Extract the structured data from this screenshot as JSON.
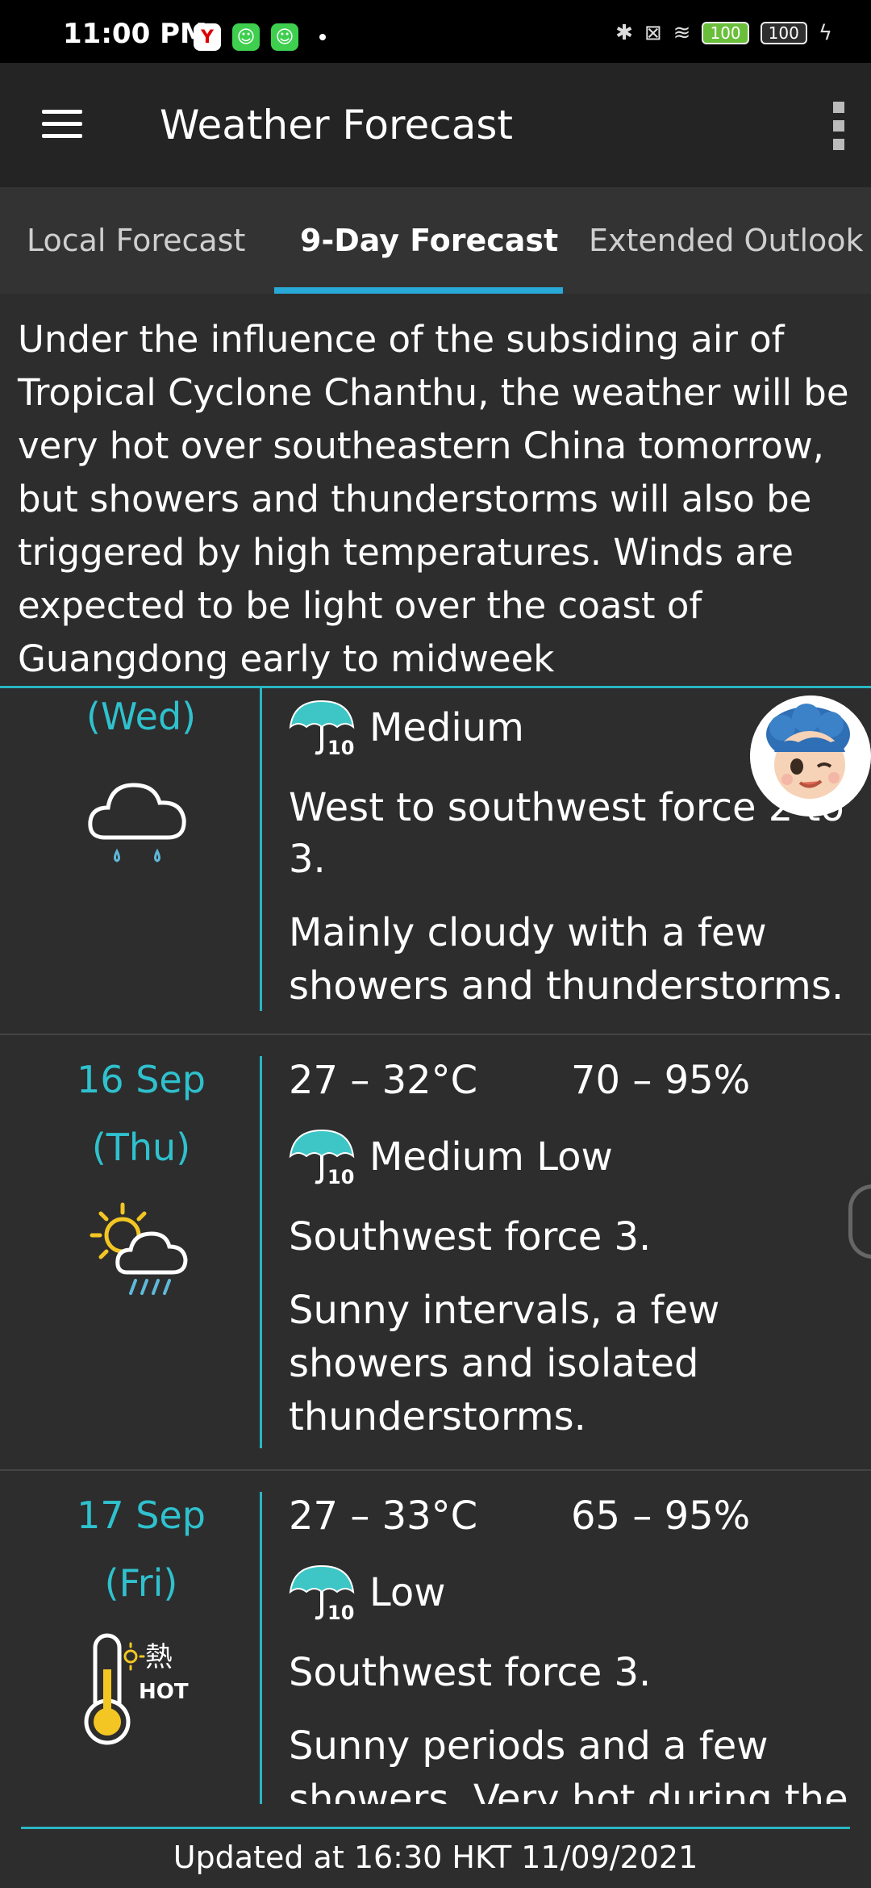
{
  "status_bar": {
    "time": "11:00 PM",
    "battery_1": "100",
    "battery_2": "100"
  },
  "app_bar": {
    "title": "Weather Forecast"
  },
  "tabs": [
    {
      "label": "Local Forecast"
    },
    {
      "label": "9-Day Forecast"
    },
    {
      "label": "Extended Outlook"
    }
  ],
  "general_situation": "Under the influence of the subsiding air of Tropical Cyclone Chanthu, the weather will be very hot over southeastern China tomorrow, but showers and thunderstorms will also be triggered by high temperatures. Winds are expected to be light over the coast of Guangdong early to midweek",
  "forecast": [
    {
      "day": "(Wed)",
      "icon": "rain-cloud-icon",
      "rain_chance": "Medium",
      "wind": "West to southwest force 2 to 3.",
      "description": "Mainly cloudy with a few showers and thunderstorms."
    },
    {
      "date": "16 Sep",
      "day": "(Thu)",
      "icon": "sun-cloud-showers-icon",
      "temperature": "27 – 32°C",
      "humidity": "70 – 95%",
      "rain_chance": "Medium Low",
      "wind": "Southwest force 3.",
      "description": "Sunny intervals, a few showers and isolated thunderstorms."
    },
    {
      "date": "17 Sep",
      "day": "(Fri)",
      "icon": "very-hot-thermometer-icon",
      "icon_text": {
        "cn": "熱",
        "en": "HOT"
      },
      "temperature": "27 – 33°C",
      "humidity": "65 – 95%",
      "rain_chance": "Low",
      "wind": "Southwest force 3.",
      "description": "Sunny periods and a few showers. Very hot during the"
    }
  ],
  "footer": {
    "updated": "Updated at 16:30 HKT 11/09/2021"
  },
  "colors": {
    "accent": "#29b6c2",
    "tab_indicator": "#29a9d8",
    "background": "#2d2d2d",
    "app_bar": "#242424"
  }
}
